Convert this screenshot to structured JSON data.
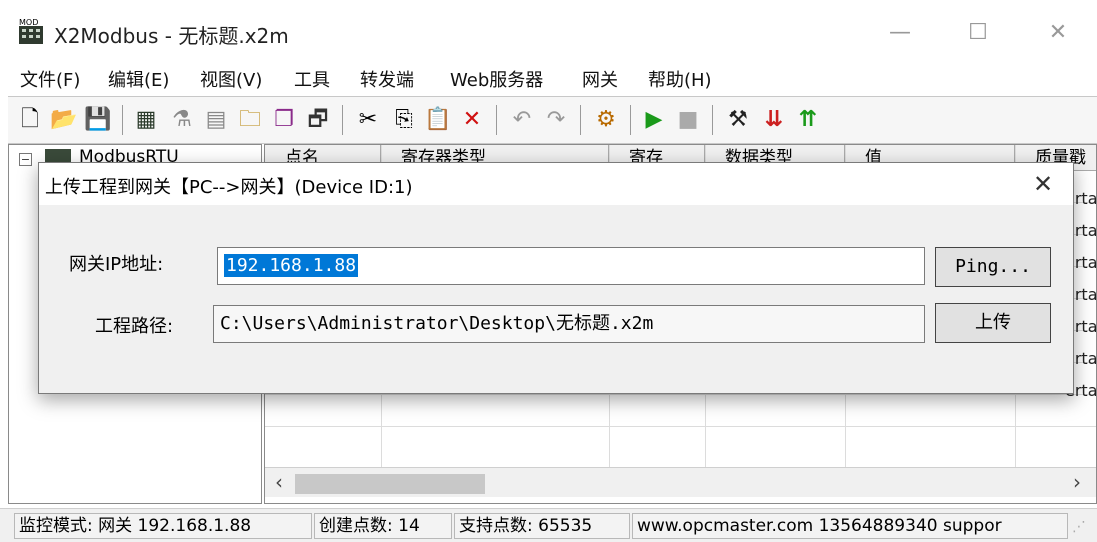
{
  "window": {
    "title": "X2Modbus - 无标题.x2m",
    "controls": {
      "minimize": "—",
      "maximize": "☐",
      "close": "✕"
    }
  },
  "menu": {
    "items": [
      {
        "label": "文件(F)"
      },
      {
        "label": "编辑(E)"
      },
      {
        "label": "视图(V)"
      },
      {
        "label": "工具"
      },
      {
        "label": "转发端"
      },
      {
        "label": "Web服务器"
      },
      {
        "label": "网关"
      },
      {
        "label": "帮助(H)"
      }
    ]
  },
  "toolbar": {
    "icons": [
      {
        "name": "new-icon",
        "glyph": "🗋"
      },
      {
        "name": "open-icon",
        "glyph": "📂"
      },
      {
        "name": "save-icon",
        "glyph": "💾"
      },
      {
        "name": "device-icon",
        "glyph": "▦"
      },
      {
        "name": "tag-icon",
        "glyph": "⚗"
      },
      {
        "name": "table-icon",
        "glyph": "▤"
      },
      {
        "name": "new-folder-icon",
        "glyph": "🗀"
      },
      {
        "name": "batch-icon",
        "glyph": "❐"
      },
      {
        "name": "properties-icon",
        "glyph": "🗗"
      },
      {
        "name": "cut-icon",
        "glyph": "✂"
      },
      {
        "name": "copy-icon",
        "glyph": "⎘"
      },
      {
        "name": "paste-icon",
        "glyph": "📋"
      },
      {
        "name": "delete-icon",
        "glyph": "✕"
      },
      {
        "name": "undo-icon",
        "glyph": "↶"
      },
      {
        "name": "redo-icon",
        "glyph": "↷"
      },
      {
        "name": "monitor-icon",
        "glyph": "⚙"
      },
      {
        "name": "run-icon",
        "glyph": "▶"
      },
      {
        "name": "stop-icon",
        "glyph": "■"
      },
      {
        "name": "tools-icon",
        "glyph": "⚒"
      },
      {
        "name": "load-icon",
        "glyph": "⇊"
      },
      {
        "name": "upload-icon",
        "glyph": "⇈"
      }
    ]
  },
  "tree": {
    "root_label": "ModbusRTU",
    "expander": "−"
  },
  "grid": {
    "headers": [
      "点名",
      "寄存器类型",
      "寄存",
      "数据类型",
      "值",
      "质量戳"
    ],
    "quality_cells": [
      "erta",
      "erta",
      "erta",
      "erta",
      "erta",
      "erta",
      "erta"
    ],
    "scroll_left": "‹",
    "scroll_right": "›"
  },
  "dialog": {
    "title": "上传工程到网关【PC-->网关】(Device ID:1)",
    "close": "✕",
    "ip_label": "网关IP地址:",
    "ip_value": "192.168.1.88",
    "path_label": "工程路径:",
    "path_value": "C:\\Users\\Administrator\\Desktop\\无标题.x2m",
    "ping_button": "Ping...",
    "upload_button": "上传"
  },
  "status": {
    "mode": "监控模式: 网关 192.168.1.88",
    "created": "创建点数: 14",
    "supported": "支持点数: 65535",
    "contact": "www.opcmaster.com 13564889340 suppor"
  },
  "colors": {
    "selection": "#0078d7",
    "run_green": "#1a9a1a",
    "delete_red": "#d01010",
    "dialog_bg": "#f0f0f0"
  }
}
